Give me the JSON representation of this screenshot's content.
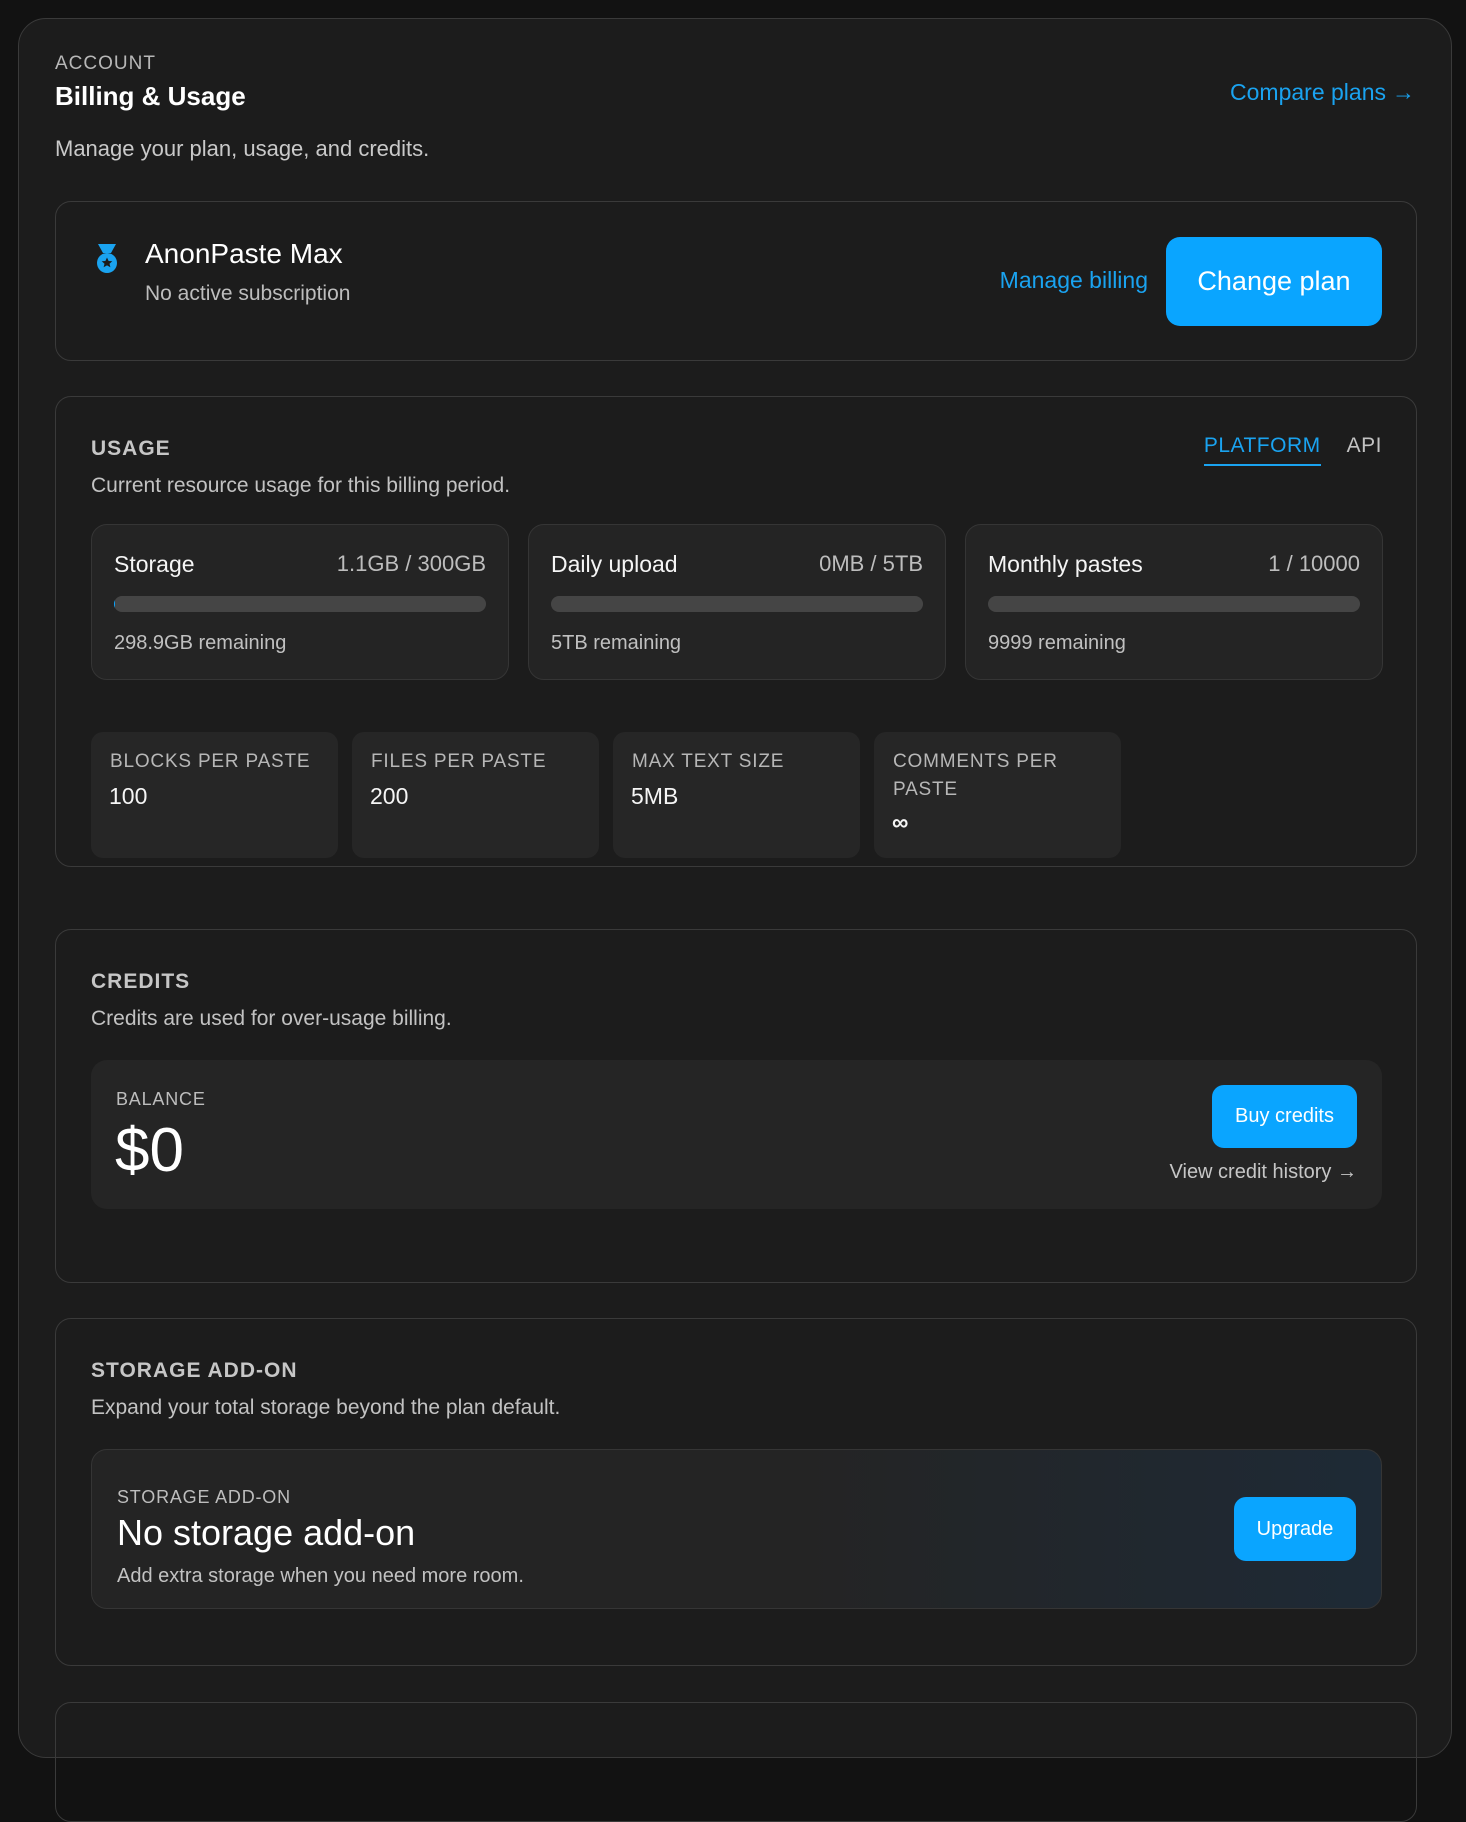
{
  "header": {
    "eyebrow": "ACCOUNT",
    "title": "Billing & Usage",
    "subtitle": "Manage your plan, usage, and credits.",
    "compare_link": "Compare plans",
    "compare_arrow": "→"
  },
  "plan": {
    "icon": "medal-icon",
    "name": "AnonPaste Max",
    "status": "No active subscription",
    "manage_billing": "Manage billing",
    "change_plan": "Change plan"
  },
  "usage": {
    "title": "USAGE",
    "description": "Current resource usage for this billing period.",
    "tabs": [
      {
        "label": "PLATFORM",
        "active": true
      },
      {
        "label": "API",
        "active": false
      }
    ],
    "meters": [
      {
        "label": "Storage",
        "value": "1.1GB / 300GB",
        "remaining": "298.9GB remaining",
        "fraction": 0.0037
      },
      {
        "label": "Daily upload",
        "value": "0MB / 5TB",
        "remaining": "5TB remaining",
        "fraction": 0
      },
      {
        "label": "Monthly pastes",
        "value": "1 / 10000",
        "remaining": "9999 remaining",
        "fraction": 0.0001
      }
    ],
    "limits": [
      {
        "label": "BLOCKS PER PASTE",
        "value": "100"
      },
      {
        "label": "FILES PER PASTE",
        "value": "200"
      },
      {
        "label": "MAX TEXT SIZE",
        "value": "5MB"
      },
      {
        "label": "COMMENTS PER PASTE",
        "value": "∞"
      }
    ]
  },
  "credits": {
    "title": "CREDITS",
    "description": "Credits are used for over-usage billing.",
    "balance_label": "BALANCE",
    "balance": "$0",
    "buy_button": "Buy credits",
    "history_link": "View credit history",
    "history_arrow": "→"
  },
  "storage_addon": {
    "title": "STORAGE ADD-ON",
    "description": "Expand your total storage beyond the plan default.",
    "box_label": "STORAGE ADD-ON",
    "box_title": "No storage add-on",
    "box_desc": "Add extra storage when you need more room.",
    "upgrade_button": "Upgrade"
  },
  "colors": {
    "accent": "#0aa5ff",
    "link": "#1aa3f0",
    "background": "#1c1c1c"
  }
}
